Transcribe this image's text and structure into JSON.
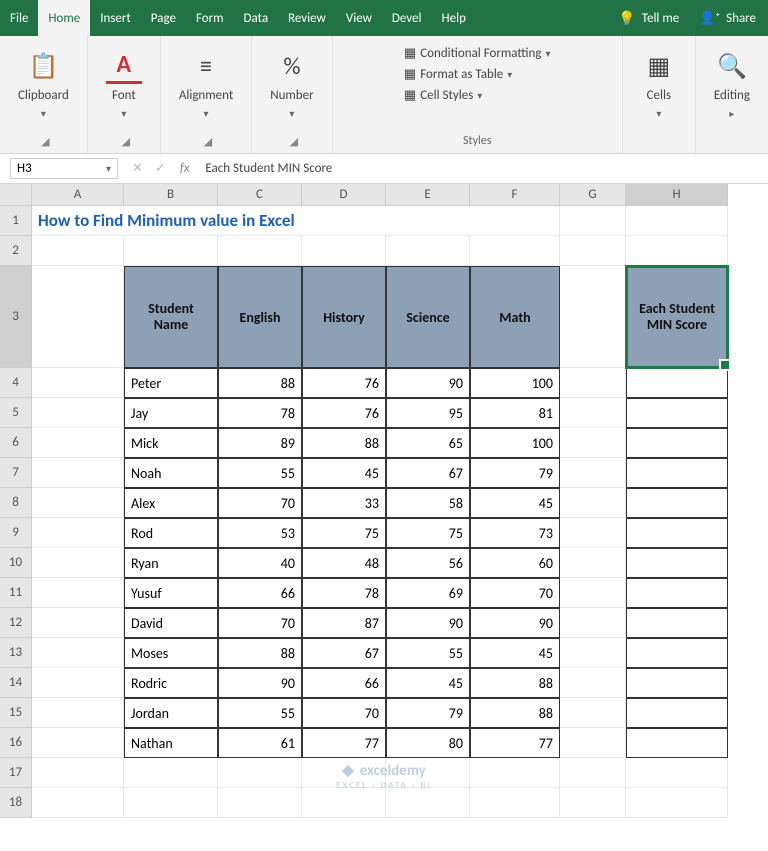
{
  "tabs": {
    "file": "File",
    "home": "Home",
    "insert": "Insert",
    "page": "Page",
    "form": "Form",
    "data": "Data",
    "review": "Review",
    "view": "View",
    "devel": "Devel",
    "help": "Help",
    "tellme": "Tell me",
    "share": "Share"
  },
  "ribbon": {
    "clipboard": "Clipboard",
    "font": "Font",
    "alignment": "Alignment",
    "number": "Number",
    "styles": "Styles",
    "condfmt": "Conditional Formatting",
    "fmttable": "Format as Table",
    "cellstyles": "Cell Styles",
    "cells": "Cells",
    "editing": "Editing"
  },
  "fbar": {
    "ref": "H3",
    "value": "Each Student MIN Score",
    "fx": "fx"
  },
  "cols": [
    "A",
    "B",
    "C",
    "D",
    "E",
    "F",
    "G",
    "H"
  ],
  "title": "How to Find Minimum value in Excel",
  "table": {
    "headers": {
      "name": "Student Name",
      "eng": "English",
      "hist": "History",
      "sci": "Science",
      "math": "Math"
    },
    "min_header": "Each Student MIN Score",
    "rows": [
      {
        "name": "Peter",
        "eng": 88,
        "hist": 76,
        "sci": 90,
        "math": 100
      },
      {
        "name": "Jay",
        "eng": 78,
        "hist": 76,
        "sci": 95,
        "math": 81
      },
      {
        "name": "Mick",
        "eng": 89,
        "hist": 88,
        "sci": 65,
        "math": 100
      },
      {
        "name": "Noah",
        "eng": 55,
        "hist": 45,
        "sci": 67,
        "math": 79
      },
      {
        "name": "Alex",
        "eng": 70,
        "hist": 33,
        "sci": 58,
        "math": 45
      },
      {
        "name": "Rod",
        "eng": 53,
        "hist": 75,
        "sci": 75,
        "math": 73
      },
      {
        "name": "Ryan",
        "eng": 40,
        "hist": 48,
        "sci": 56,
        "math": 60
      },
      {
        "name": "Yusuf",
        "eng": 66,
        "hist": 78,
        "sci": 69,
        "math": 70
      },
      {
        "name": "David",
        "eng": 70,
        "hist": 87,
        "sci": 90,
        "math": 90
      },
      {
        "name": "Moses",
        "eng": 88,
        "hist": 67,
        "sci": 55,
        "math": 45
      },
      {
        "name": "Rodric",
        "eng": 90,
        "hist": 66,
        "sci": 45,
        "math": 88
      },
      {
        "name": "Jordan",
        "eng": 55,
        "hist": 70,
        "sci": 79,
        "math": 88
      },
      {
        "name": "Nathan",
        "eng": 61,
        "hist": 77,
        "sci": 80,
        "math": 77
      }
    ]
  },
  "watermark": {
    "main": "exceldemy",
    "sub": "EXCEL · DATA · BI"
  },
  "chart_data": {
    "type": "table",
    "title": "How to Find Minimum value in Excel",
    "columns": [
      "Student Name",
      "English",
      "History",
      "Science",
      "Math"
    ],
    "rows": [
      [
        "Peter",
        88,
        76,
        90,
        100
      ],
      [
        "Jay",
        78,
        76,
        95,
        81
      ],
      [
        "Mick",
        89,
        88,
        65,
        100
      ],
      [
        "Noah",
        55,
        45,
        67,
        79
      ],
      [
        "Alex",
        70,
        33,
        58,
        45
      ],
      [
        "Rod",
        53,
        75,
        75,
        73
      ],
      [
        "Ryan",
        40,
        48,
        56,
        60
      ],
      [
        "Yusuf",
        66,
        78,
        69,
        70
      ],
      [
        "David",
        70,
        87,
        90,
        90
      ],
      [
        "Moses",
        88,
        67,
        55,
        45
      ],
      [
        "Rodric",
        90,
        66,
        45,
        88
      ],
      [
        "Jordan",
        55,
        70,
        79,
        88
      ],
      [
        "Nathan",
        61,
        77,
        80,
        77
      ]
    ]
  }
}
